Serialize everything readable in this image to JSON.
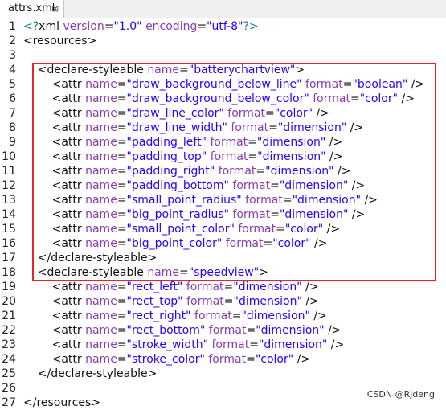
{
  "tab": {
    "title": "attrs.xml",
    "close_icon": "close-icon"
  },
  "lines": [
    {
      "n": "1",
      "tokens": [
        [
          "c-punct",
          "<?"
        ],
        [
          "c-tag",
          "xml "
        ],
        [
          "c-attr",
          "version"
        ],
        [
          "c-eq",
          "="
        ],
        [
          "c-val",
          "\"1.0\""
        ],
        [
          "c-tag",
          " "
        ],
        [
          "c-attr",
          "encoding"
        ],
        [
          "c-eq",
          "="
        ],
        [
          "c-val",
          "\"utf-8\""
        ],
        [
          "c-punct",
          "?>"
        ]
      ]
    },
    {
      "n": "2",
      "tokens": [
        [
          "c-tag",
          "<resources>"
        ]
      ]
    },
    {
      "n": "3",
      "tokens": []
    },
    {
      "n": "4",
      "tokens": [
        [
          "c-tag",
          "    <declare-styleable "
        ],
        [
          "c-attr",
          "name"
        ],
        [
          "c-eq",
          "="
        ],
        [
          "c-val",
          "\"batterychartview\""
        ],
        [
          "c-tag",
          ">"
        ]
      ]
    },
    {
      "n": "5",
      "tokens": [
        [
          "c-tag",
          "        <attr "
        ],
        [
          "c-attr",
          "name"
        ],
        [
          "c-eq",
          "="
        ],
        [
          "c-val",
          "\"draw_background_below_line\""
        ],
        [
          "c-tag",
          " "
        ],
        [
          "c-attr",
          "format"
        ],
        [
          "c-eq",
          "="
        ],
        [
          "c-val",
          "\"boolean\""
        ],
        [
          "c-tag",
          " />"
        ]
      ]
    },
    {
      "n": "6",
      "tokens": [
        [
          "c-tag",
          "        <attr "
        ],
        [
          "c-attr",
          "name"
        ],
        [
          "c-eq",
          "="
        ],
        [
          "c-val",
          "\"draw_background_below_color\""
        ],
        [
          "c-tag",
          " "
        ],
        [
          "c-attr",
          "format"
        ],
        [
          "c-eq",
          "="
        ],
        [
          "c-val",
          "\"color\""
        ],
        [
          "c-tag",
          " />"
        ]
      ]
    },
    {
      "n": "7",
      "tokens": [
        [
          "c-tag",
          "        <attr "
        ],
        [
          "c-attr",
          "name"
        ],
        [
          "c-eq",
          "="
        ],
        [
          "c-val",
          "\"draw_line_color\""
        ],
        [
          "c-tag",
          " "
        ],
        [
          "c-attr",
          "format"
        ],
        [
          "c-eq",
          "="
        ],
        [
          "c-val",
          "\"color\""
        ],
        [
          "c-tag",
          " />"
        ]
      ]
    },
    {
      "n": "8",
      "tokens": [
        [
          "c-tag",
          "        <attr "
        ],
        [
          "c-attr",
          "name"
        ],
        [
          "c-eq",
          "="
        ],
        [
          "c-val",
          "\"draw_line_width\""
        ],
        [
          "c-tag",
          " "
        ],
        [
          "c-attr",
          "format"
        ],
        [
          "c-eq",
          "="
        ],
        [
          "c-val",
          "\"dimension\""
        ],
        [
          "c-tag",
          " />"
        ]
      ]
    },
    {
      "n": "9",
      "tokens": [
        [
          "c-tag",
          "        <attr "
        ],
        [
          "c-attr",
          "name"
        ],
        [
          "c-eq",
          "="
        ],
        [
          "c-val",
          "\"padding_left\""
        ],
        [
          "c-tag",
          " "
        ],
        [
          "c-attr",
          "format"
        ],
        [
          "c-eq",
          "="
        ],
        [
          "c-val",
          "\"dimension\""
        ],
        [
          "c-tag",
          " />"
        ]
      ]
    },
    {
      "n": "10",
      "tokens": [
        [
          "c-tag",
          "        <attr "
        ],
        [
          "c-attr",
          "name"
        ],
        [
          "c-eq",
          "="
        ],
        [
          "c-val",
          "\"padding_top\""
        ],
        [
          "c-tag",
          " "
        ],
        [
          "c-attr",
          "format"
        ],
        [
          "c-eq",
          "="
        ],
        [
          "c-val",
          "\"dimension\""
        ],
        [
          "c-tag",
          " />"
        ]
      ]
    },
    {
      "n": "11",
      "tokens": [
        [
          "c-tag",
          "        <attr "
        ],
        [
          "c-attr",
          "name"
        ],
        [
          "c-eq",
          "="
        ],
        [
          "c-val",
          "\"padding_right\""
        ],
        [
          "c-tag",
          " "
        ],
        [
          "c-attr",
          "format"
        ],
        [
          "c-eq",
          "="
        ],
        [
          "c-val",
          "\"dimension\""
        ],
        [
          "c-tag",
          " />"
        ]
      ]
    },
    {
      "n": "12",
      "tokens": [
        [
          "c-tag",
          "        <attr "
        ],
        [
          "c-attr",
          "name"
        ],
        [
          "c-eq",
          "="
        ],
        [
          "c-val",
          "\"padding_bottom\""
        ],
        [
          "c-tag",
          " "
        ],
        [
          "c-attr",
          "format"
        ],
        [
          "c-eq",
          "="
        ],
        [
          "c-val",
          "\"dimension\""
        ],
        [
          "c-tag",
          " />"
        ]
      ]
    },
    {
      "n": "13",
      "tokens": [
        [
          "c-tag",
          "        <attr "
        ],
        [
          "c-attr",
          "name"
        ],
        [
          "c-eq",
          "="
        ],
        [
          "c-val",
          "\"small_point_radius\""
        ],
        [
          "c-tag",
          " "
        ],
        [
          "c-attr",
          "format"
        ],
        [
          "c-eq",
          "="
        ],
        [
          "c-val",
          "\"dimension\""
        ],
        [
          "c-tag",
          " />"
        ]
      ]
    },
    {
      "n": "14",
      "tokens": [
        [
          "c-tag",
          "        <attr "
        ],
        [
          "c-attr",
          "name"
        ],
        [
          "c-eq",
          "="
        ],
        [
          "c-val",
          "\"big_point_radius\""
        ],
        [
          "c-tag",
          " "
        ],
        [
          "c-attr",
          "format"
        ],
        [
          "c-eq",
          "="
        ],
        [
          "c-val",
          "\"dimension\""
        ],
        [
          "c-tag",
          " />"
        ]
      ]
    },
    {
      "n": "15",
      "tokens": [
        [
          "c-tag",
          "        <attr "
        ],
        [
          "c-attr",
          "name"
        ],
        [
          "c-eq",
          "="
        ],
        [
          "c-val",
          "\"small_point_color\""
        ],
        [
          "c-tag",
          " "
        ],
        [
          "c-attr",
          "format"
        ],
        [
          "c-eq",
          "="
        ],
        [
          "c-val",
          "\"color\""
        ],
        [
          "c-tag",
          " />"
        ]
      ]
    },
    {
      "n": "16",
      "tokens": [
        [
          "c-tag",
          "        <attr "
        ],
        [
          "c-attr",
          "name"
        ],
        [
          "c-eq",
          "="
        ],
        [
          "c-val",
          "\"big_point_color\""
        ],
        [
          "c-tag",
          " "
        ],
        [
          "c-attr",
          "format"
        ],
        [
          "c-eq",
          "="
        ],
        [
          "c-val",
          "\"color\""
        ],
        [
          "c-tag",
          " />"
        ]
      ]
    },
    {
      "n": "17",
      "tokens": [
        [
          "c-tag",
          "    </declare-styleable>"
        ]
      ]
    },
    {
      "n": "18",
      "tokens": [
        [
          "c-tag",
          "    <declare-styleable "
        ],
        [
          "c-attr",
          "name"
        ],
        [
          "c-eq",
          "="
        ],
        [
          "c-val",
          "\"speedview\""
        ],
        [
          "c-tag",
          ">"
        ]
      ]
    },
    {
      "n": "19",
      "tokens": [
        [
          "c-tag",
          "        <attr "
        ],
        [
          "c-attr",
          "name"
        ],
        [
          "c-eq",
          "="
        ],
        [
          "c-val",
          "\"rect_left\""
        ],
        [
          "c-tag",
          " "
        ],
        [
          "c-attr",
          "format"
        ],
        [
          "c-eq",
          "="
        ],
        [
          "c-val",
          "\"dimension\""
        ],
        [
          "c-tag",
          " />"
        ]
      ]
    },
    {
      "n": "20",
      "tokens": [
        [
          "c-tag",
          "        <attr "
        ],
        [
          "c-attr",
          "name"
        ],
        [
          "c-eq",
          "="
        ],
        [
          "c-val",
          "\"rect_top\""
        ],
        [
          "c-tag",
          " "
        ],
        [
          "c-attr",
          "format"
        ],
        [
          "c-eq",
          "="
        ],
        [
          "c-val",
          "\"dimension\""
        ],
        [
          "c-tag",
          " />"
        ]
      ]
    },
    {
      "n": "21",
      "tokens": [
        [
          "c-tag",
          "        <attr "
        ],
        [
          "c-attr",
          "name"
        ],
        [
          "c-eq",
          "="
        ],
        [
          "c-val",
          "\"rect_right\""
        ],
        [
          "c-tag",
          " "
        ],
        [
          "c-attr",
          "format"
        ],
        [
          "c-eq",
          "="
        ],
        [
          "c-val",
          "\"dimension\""
        ],
        [
          "c-tag",
          " />"
        ]
      ]
    },
    {
      "n": "22",
      "tokens": [
        [
          "c-tag",
          "        <attr "
        ],
        [
          "c-attr",
          "name"
        ],
        [
          "c-eq",
          "="
        ],
        [
          "c-val",
          "\"rect_bottom\""
        ],
        [
          "c-tag",
          " "
        ],
        [
          "c-attr",
          "format"
        ],
        [
          "c-eq",
          "="
        ],
        [
          "c-val",
          "\"dimension\""
        ],
        [
          "c-tag",
          " />"
        ]
      ]
    },
    {
      "n": "23",
      "tokens": [
        [
          "c-tag",
          "        <attr "
        ],
        [
          "c-attr",
          "name"
        ],
        [
          "c-eq",
          "="
        ],
        [
          "c-val",
          "\"stroke_width\""
        ],
        [
          "c-tag",
          " "
        ],
        [
          "c-attr",
          "format"
        ],
        [
          "c-eq",
          "="
        ],
        [
          "c-val",
          "\"dimension\""
        ],
        [
          "c-tag",
          " />"
        ]
      ]
    },
    {
      "n": "24",
      "tokens": [
        [
          "c-tag",
          "        <attr "
        ],
        [
          "c-attr",
          "name"
        ],
        [
          "c-eq",
          "="
        ],
        [
          "c-val",
          "\"stroke_color\""
        ],
        [
          "c-tag",
          " "
        ],
        [
          "c-attr",
          "format"
        ],
        [
          "c-eq",
          "="
        ],
        [
          "c-val",
          "\"color\""
        ],
        [
          "c-tag",
          " />"
        ]
      ]
    },
    {
      "n": "25",
      "tokens": [
        [
          "c-tag",
          "    </declare-styleable>"
        ]
      ]
    },
    {
      "n": "26",
      "tokens": []
    },
    {
      "n": "27",
      "tokens": [
        [
          "c-tag",
          "</resources>"
        ]
      ]
    }
  ],
  "highlight": {
    "start_line": "4",
    "end_line": "17",
    "color": "#e0252c"
  },
  "watermark": "CSDN @Rjdeng"
}
